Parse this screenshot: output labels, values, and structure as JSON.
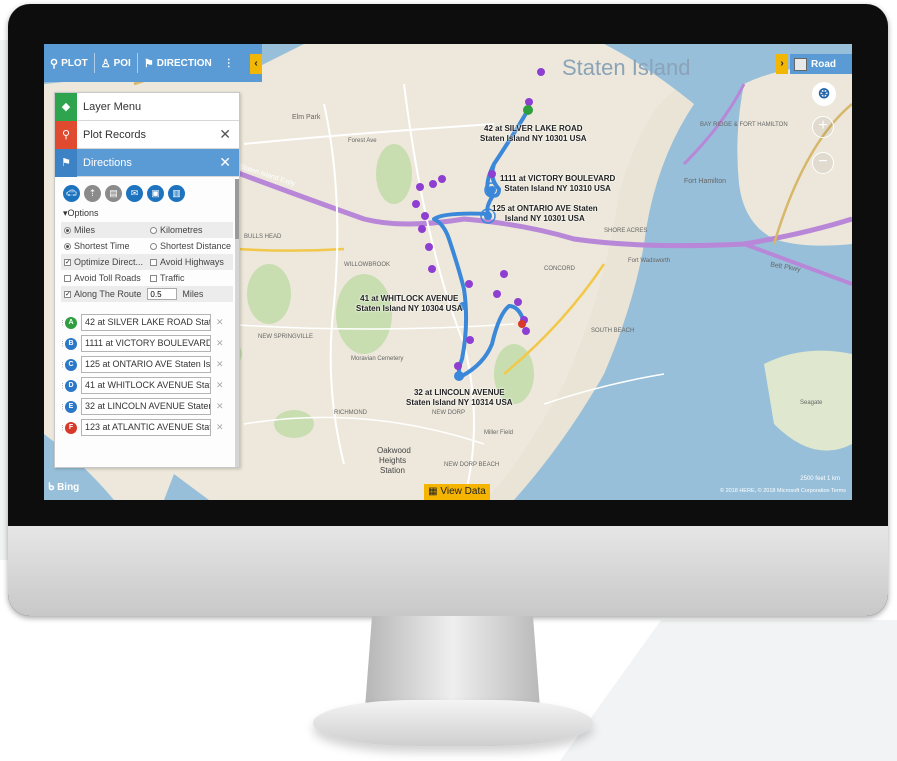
{
  "plot_toolbar": {
    "plot_label": "PLOT",
    "poi_label": "POI",
    "direction_label": "DIRECTION",
    "more_label": "⋮",
    "collapse_label": "‹"
  },
  "panel": {
    "layer_menu_label": "Layer Menu",
    "plot_records_label": "Plot Records",
    "directions_label": "Directions",
    "close_label": "✕",
    "options_title": "▾Options",
    "options": {
      "miles": "Miles",
      "kilometres": "Kilometres",
      "shortest_time": "Shortest Time",
      "shortest_distance": "Shortest Distance",
      "optimize_direct": "Optimize Direct...",
      "avoid_highways": "Avoid Highways",
      "avoid_toll_roads": "Avoid Toll Roads",
      "traffic": "Traffic",
      "along_the_route": "Along The Route",
      "along_value": "0.5",
      "along_unit": "Miles"
    },
    "stops": [
      {
        "letter": "A",
        "color": "#2e9e3e",
        "text": "42 at SILVER LAKE ROAD State"
      },
      {
        "letter": "B",
        "color": "#2c78c8",
        "text": "1111 at VICTORY BOULEVARD"
      },
      {
        "letter": "C",
        "color": "#2c78c8",
        "text": "125 at ONTARIO AVE Staten Isl"
      },
      {
        "letter": "D",
        "color": "#2c78c8",
        "text": "41 at WHITLOCK AVENUE Stat"
      },
      {
        "letter": "E",
        "color": "#2c78c8",
        "text": "32 at LINCOLN AVENUE Staten"
      },
      {
        "letter": "F",
        "color": "#d73a2a",
        "text": "123 at ATLANTIC AVENUE Stat"
      }
    ]
  },
  "map": {
    "style_button": "Road",
    "expand_label": "›",
    "zoom_in": "+",
    "zoom_out": "−",
    "city_label": "Staten Island",
    "bing_label": "Bing",
    "view_data_label": "View Data",
    "scale_text": "2500 feet        1 km",
    "copyright_text": "© 2018 HERE, © 2018 Microsoft Corporation  Terms",
    "route_labels": [
      "42 at SILVER LAKE ROAD",
      "Staten Island NY 10301 USA",
      "1111 at VICTORY BOULEVARD",
      "Staten Island NY 10310 USA",
      "125 at ONTARIO AVE Staten",
      "Island NY 10301 USA",
      "41 at WHITLOCK AVENUE",
      "Staten Island NY 10304 USA",
      "32 at LINCOLN AVENUE",
      "Staten Island NY 10314 USA"
    ],
    "area_labels": [
      "Elm Park",
      "Fort Hamilton",
      "Seagate",
      "Oakwood",
      "Heights",
      "Station",
      "CONCORD",
      "SOUTH BEACH",
      "NEW DORP",
      "BULLS HEAD",
      "WILLOWBROOK",
      "Belt Pkwy",
      "Staten Island Expy",
      "RICHMOND",
      "NEW SPRINGVILLE",
      "NEW DORP BEACH",
      "Fort Wadsworth",
      "SHORE ACRES",
      "BAY RIDGE & FORT HAMILTON",
      "Moravian Cemetery",
      "Miller Field",
      "Forest Ave"
    ]
  }
}
